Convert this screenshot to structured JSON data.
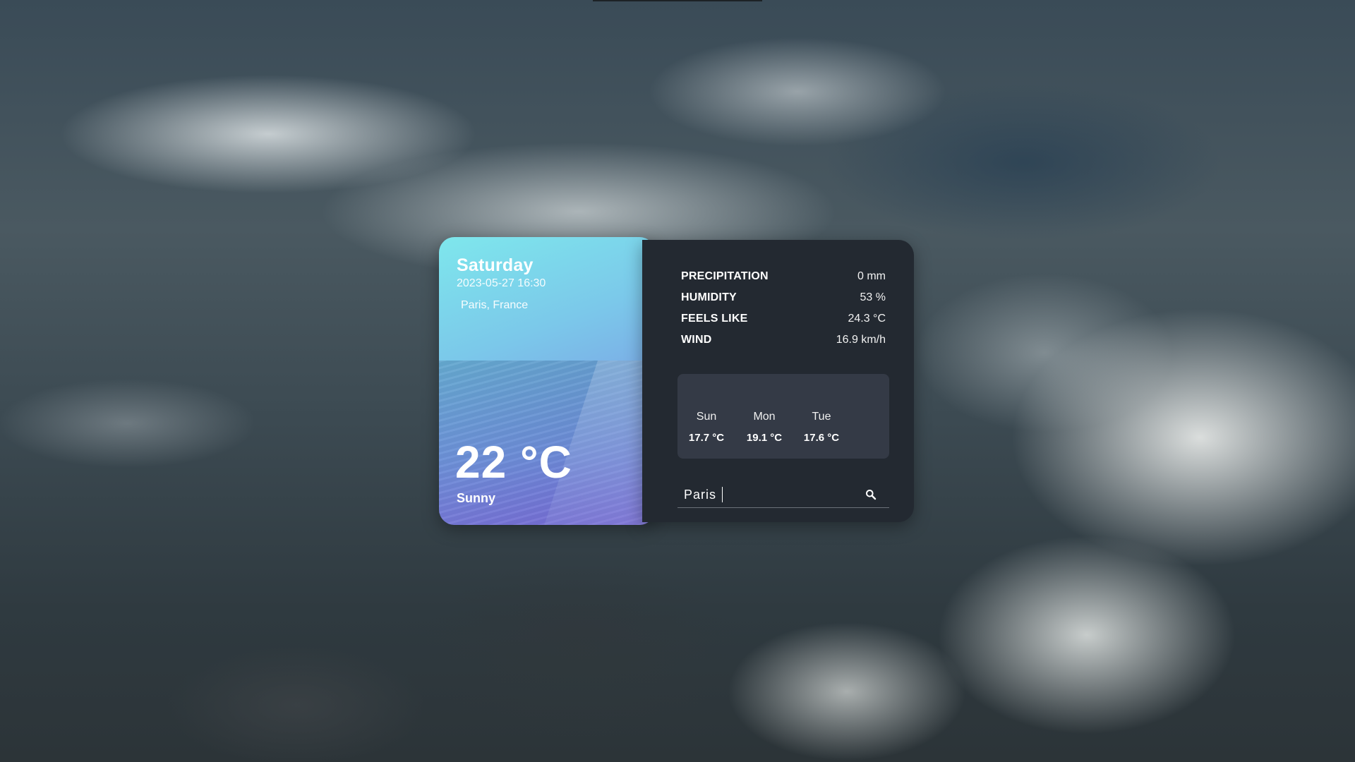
{
  "app": {
    "day": "Saturday",
    "datetime": "2023-05-27 16:30",
    "location": "Paris, France",
    "temperature": "22 °C",
    "condition": "Sunny"
  },
  "stats": [
    {
      "label": "PRECIPITATION",
      "value": "0 mm"
    },
    {
      "label": "HUMIDITY",
      "value": "53 %"
    },
    {
      "label": "FEELS LIKE",
      "value": "24.3 °C"
    },
    {
      "label": "WIND",
      "value": "16.9 km/h"
    }
  ],
  "forecast": [
    {
      "day": "Sun",
      "temp": "17.7 °C"
    },
    {
      "day": "Mon",
      "temp": "19.1 °C"
    },
    {
      "day": "Tue",
      "temp": "17.6 °C"
    }
  ],
  "search": {
    "value": "Paris",
    "icon": "search-icon"
  },
  "colors": {
    "card_gradient_start": "#7ee7ec",
    "card_gradient_end": "#7a6fdc",
    "panel_bg": "#232931",
    "forecast_bg": "#343a46"
  }
}
